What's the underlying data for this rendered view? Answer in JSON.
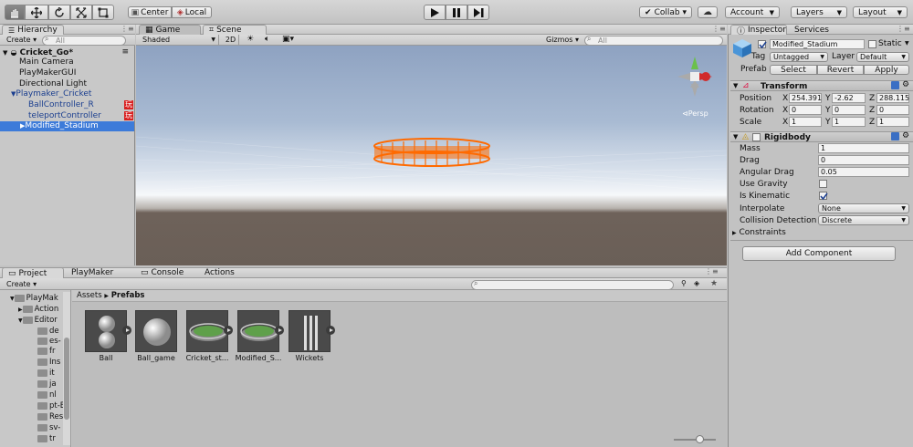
{
  "toolbar": {
    "pivot_center": "Center",
    "pivot_local": "Local",
    "collab": "Collab ▾",
    "account": "Account",
    "layers": "Layers",
    "layout": "Layout"
  },
  "hierarchy": {
    "tab": "Hierarchy",
    "create": "Create ▾",
    "search_placeholder": "All",
    "scene_name": "Cricket_Go*",
    "items": [
      {
        "label": "Main Camera"
      },
      {
        "label": "PlayMakerGUI"
      },
      {
        "label": "Directional Light"
      },
      {
        "label": "Playmaker_Cricket"
      },
      {
        "label": "BallController_R"
      },
      {
        "label": "teleportController"
      },
      {
        "label": "Modified_Stadium"
      }
    ],
    "badge_glyph": "玩"
  },
  "scene": {
    "tabs": [
      "Game",
      "Scene"
    ],
    "shading": "Shaded",
    "mode_2d": "2D",
    "gizmos": "Gizmos ▾",
    "search_placeholder": "All",
    "persp_label": "Persp",
    "colors": {
      "sky_top": "#8fa3c0",
      "horizon": "#f4f6f8",
      "ground": "#6e625a",
      "stadium": "#ff6a00"
    }
  },
  "project": {
    "tabs": [
      "Project",
      "PlayMaker",
      "Console",
      "Actions"
    ],
    "create": "Create ▾",
    "breadcrumb_root": "Assets",
    "breadcrumb_current": "Prefabs",
    "tree": [
      "PlayMak",
      "Action",
      "Editor",
      "de",
      "es-",
      "fr",
      "Ins",
      "it",
      "ja",
      "nl",
      "pt-E",
      "Res",
      "sv-",
      "tr"
    ],
    "assets": [
      {
        "label": "Ball"
      },
      {
        "label": "Ball_game"
      },
      {
        "label": "Cricket_st..."
      },
      {
        "label": "Modified_S..."
      },
      {
        "label": "Wickets"
      }
    ]
  },
  "inspector": {
    "tabs": [
      "Inspector",
      "Services"
    ],
    "object_name": "Modified_Stadium",
    "static_label": "Static",
    "tag_label": "Tag",
    "tag_value": "Untagged",
    "layer_label": "Layer",
    "layer_value": "Default",
    "prefab_label": "Prefab",
    "prefab_buttons": [
      "Select",
      "Revert",
      "Apply"
    ],
    "transform": {
      "title": "Transform",
      "position_label": "Position",
      "rotation_label": "Rotation",
      "scale_label": "Scale",
      "axis_x": "X",
      "axis_y": "Y",
      "axis_z": "Z",
      "position": [
        "254.391",
        "-2.62",
        "288.115"
      ],
      "rotation": [
        "0",
        "0",
        "0"
      ],
      "scale": [
        "1",
        "1",
        "1"
      ]
    },
    "rigidbody": {
      "title": "Rigidbody",
      "mass_label": "Mass",
      "mass": "1",
      "drag_label": "Drag",
      "drag": "0",
      "angular_drag_label": "Angular Drag",
      "angular_drag": "0.05",
      "use_gravity_label": "Use Gravity",
      "is_kinematic_label": "Is Kinematic",
      "interpolate_label": "Interpolate",
      "interpolate": "None",
      "collision_label": "Collision Detection",
      "collision": "Discrete",
      "constraints_label": "Constraints"
    },
    "add_component": "Add Component"
  }
}
